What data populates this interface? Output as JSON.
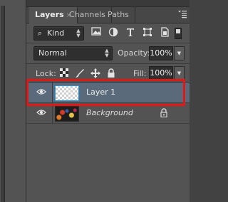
{
  "tabs": [
    {
      "label": "Layers",
      "active": true
    },
    {
      "label": "Channels",
      "active": false
    },
    {
      "label": "Paths",
      "active": false
    }
  ],
  "tab_close": "×",
  "panel_menu_icon": "menu-icon",
  "filter": {
    "search_icon": "⌕",
    "kind_label": "Kind",
    "icons": [
      "image-filter-icon",
      "adjustment-filter-icon",
      "type-filter-icon",
      "shape-filter-icon",
      "smart-object-filter-icon"
    ]
  },
  "blend": {
    "mode": "Normal",
    "opacity_label": "Opacity:",
    "opacity_value": "100%"
  },
  "lock": {
    "label": "Lock:",
    "icons": [
      "lock-transparent-pixels-icon",
      "lock-image-pixels-icon",
      "lock-position-icon",
      "lock-all-icon"
    ],
    "fill_label": "Fill:",
    "fill_value": "100%"
  },
  "layers": [
    {
      "name": "Layer 1",
      "selected": true,
      "visible": true,
      "locked": false
    },
    {
      "name": "Background",
      "selected": false,
      "visible": true,
      "locked": true
    }
  ],
  "colors": {
    "highlight": "#e01818",
    "selected_row": "#5b6a7b",
    "panel_bg": "#535353"
  }
}
